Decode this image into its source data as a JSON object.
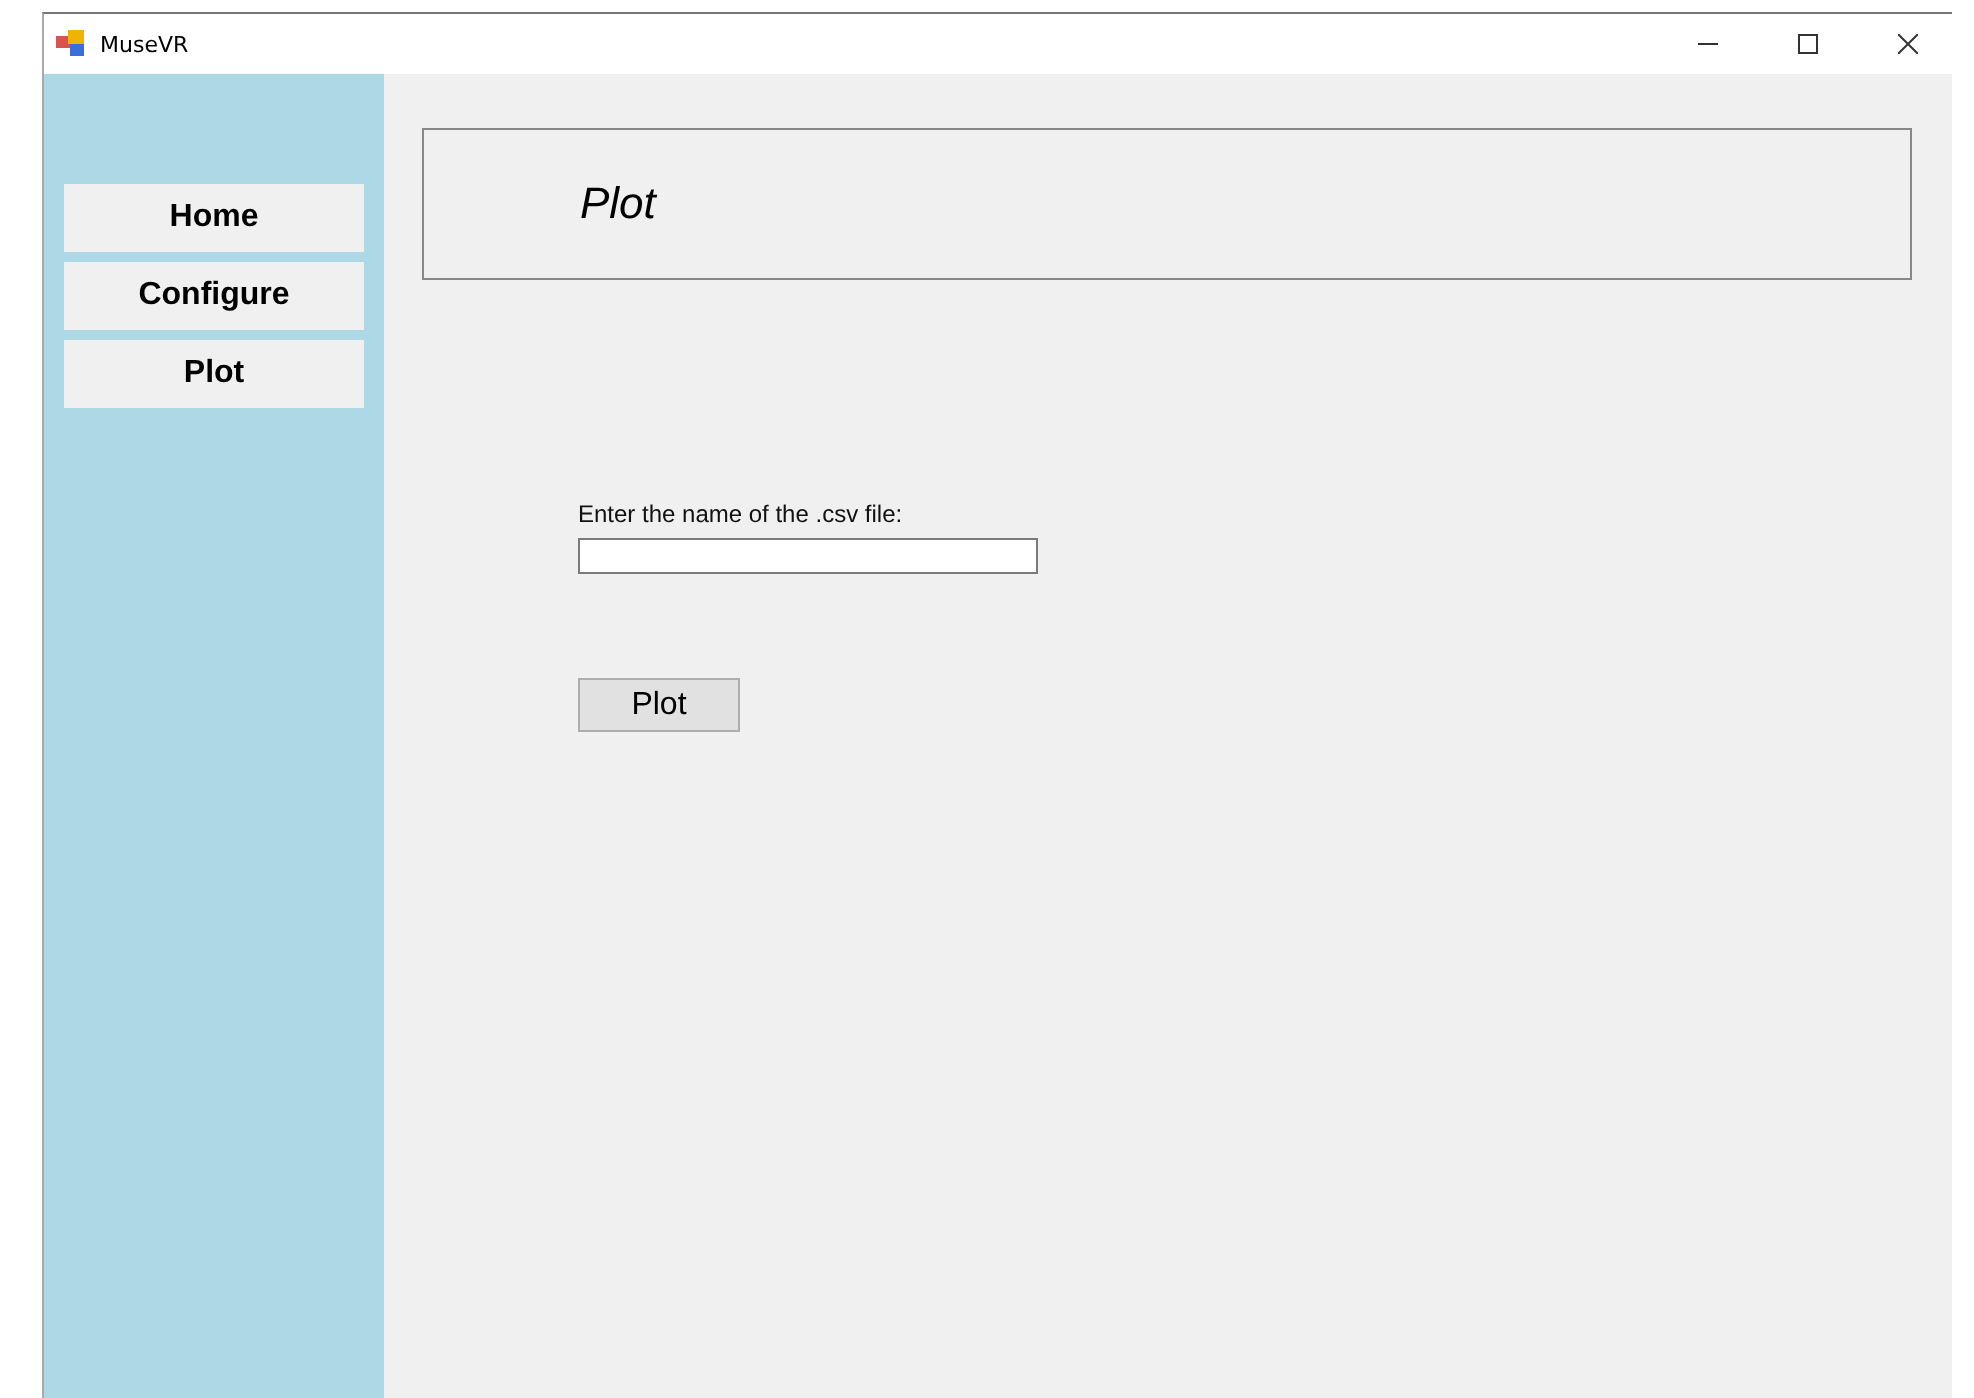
{
  "window": {
    "title": "MuseVR"
  },
  "sidebar": {
    "items": [
      {
        "label": "Home"
      },
      {
        "label": "Configure"
      },
      {
        "label": "Plot"
      }
    ]
  },
  "header": {
    "title": "Plot"
  },
  "form": {
    "label": "Enter the name of the .csv file:",
    "button": "Plot"
  }
}
